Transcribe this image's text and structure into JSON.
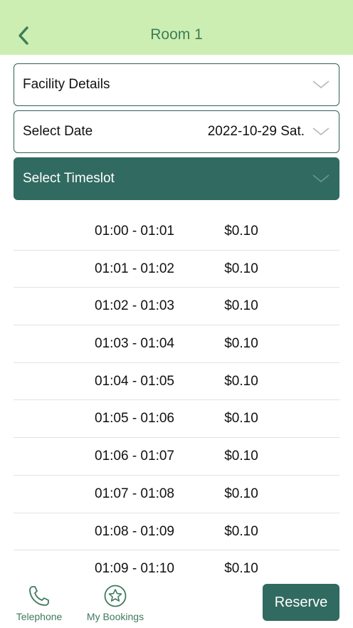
{
  "header": {
    "title": "Room 1"
  },
  "facility": {
    "label": "Facility Details"
  },
  "date": {
    "label": "Select Date",
    "value": "2022-10-29 Sat."
  },
  "timeslot": {
    "label": "Select Timeslot"
  },
  "slots": [
    {
      "time": "01:00 - 01:01",
      "price": "$0.10"
    },
    {
      "time": "01:01 - 01:02",
      "price": "$0.10"
    },
    {
      "time": "01:02 - 01:03",
      "price": "$0.10"
    },
    {
      "time": "01:03 - 01:04",
      "price": "$0.10"
    },
    {
      "time": "01:04 - 01:05",
      "price": "$0.10"
    },
    {
      "time": "01:05 - 01:06",
      "price": "$0.10"
    },
    {
      "time": "01:06 - 01:07",
      "price": "$0.10"
    },
    {
      "time": "01:07 - 01:08",
      "price": "$0.10"
    },
    {
      "time": "01:08 - 01:09",
      "price": "$0.10"
    },
    {
      "time": "01:09 - 01:10",
      "price": "$0.10"
    }
  ],
  "tabbar": {
    "telephone_label": "Telephone",
    "bookings_label": "My Bookings",
    "reserve_label": "Reserve"
  },
  "icons": {
    "back": "chevron-left-icon",
    "dropdown": "chevron-down-icon",
    "telephone": "phone-icon",
    "bookings": "star-circle-icon"
  },
  "colors": {
    "header_bg": "#cdeeb2",
    "accent": "#316a60",
    "title_text": "#3d7d5a"
  }
}
